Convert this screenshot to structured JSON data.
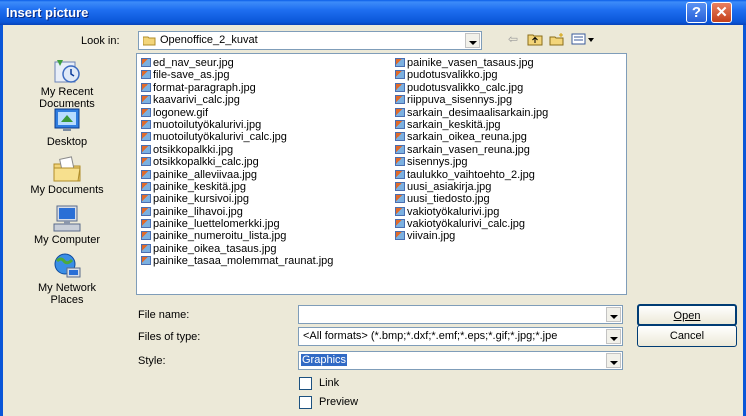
{
  "window": {
    "title": "Insert picture",
    "help_label": "?",
    "close_label": "✕"
  },
  "lookin": {
    "label": "Look in:",
    "value": "Openoffice_2_kuvat"
  },
  "toolbar_icons": [
    "back-icon",
    "up-folder-icon",
    "new-folder-icon",
    "view-menu-icon"
  ],
  "places": [
    {
      "label": "My Recent Documents",
      "icon": "recent-documents-icon"
    },
    {
      "label": "Desktop",
      "icon": "desktop-icon"
    },
    {
      "label": "My Documents",
      "icon": "my-documents-icon"
    },
    {
      "label": "My Computer",
      "icon": "my-computer-icon"
    },
    {
      "label": "My Network Places",
      "icon": "network-places-icon"
    }
  ],
  "files_col1": [
    "ed_nav_seur.jpg",
    "file-save_as.jpg",
    "format-paragraph.jpg",
    "kaavarivi_calc.jpg",
    "logonew.gif",
    "muotoilutyökalurivi.jpg",
    "muotoilutyökalurivi_calc.jpg",
    "otsikkopalkki.jpg",
    "otsikkopalkki_calc.jpg",
    "painike_alleviivaa.jpg",
    "painike_keskitä.jpg",
    "painike_kursivoi.jpg",
    "painike_lihavoi.jpg",
    "painike_luettelomerkki.jpg",
    "painike_numeroitu_lista.jpg",
    "painike_oikea_tasaus.jpg",
    "painike_tasaa_molemmat_raunat.jpg"
  ],
  "files_col2": [
    "painike_vasen_tasaus.jpg",
    "pudotusvalikko.jpg",
    "pudotusvalikko_calc.jpg",
    "riippuva_sisennys.jpg",
    "sarkain_desimaalisarkain.jpg",
    "sarkain_keskitä.jpg",
    "sarkain_oikea_reuna.jpg",
    "sarkain_vasen_reuna.jpg",
    "sisennys.jpg",
    "taulukko_vaihtoehto_2.jpg",
    "uusi_asiakirja.jpg",
    "uusi_tiedosto.jpg",
    "vakiotyökalurivi.jpg",
    "vakiotyökalurivi_calc.jpg",
    "viivain.jpg"
  ],
  "filename": {
    "label": "File name:",
    "value": ""
  },
  "filetype": {
    "label": "Files of type:",
    "value": "<All formats> (*.bmp;*.dxf;*.emf;*.eps;*.gif;*.jpg;*.jpe"
  },
  "style": {
    "label": "Style:",
    "value": "Graphics"
  },
  "buttons": {
    "open": "Open",
    "cancel": "Cancel"
  },
  "checkboxes": {
    "link": "Link",
    "preview": "Preview"
  }
}
